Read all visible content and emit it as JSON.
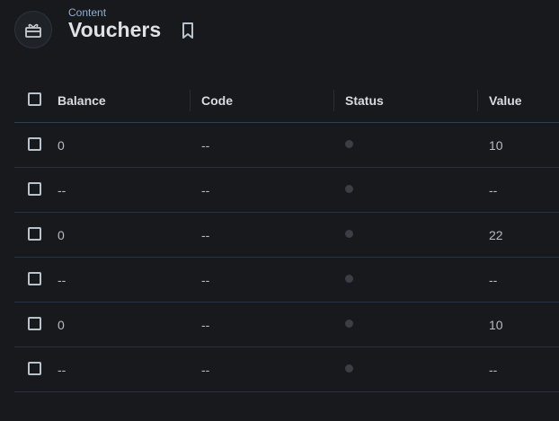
{
  "header": {
    "breadcrumb": "Content",
    "title": "Vouchers",
    "avatar_icon": "gift-icon",
    "bookmark_icon": "bookmark-icon"
  },
  "table": {
    "columns": [
      "Balance",
      "Code",
      "Status",
      "Value"
    ],
    "rows": [
      {
        "balance": "0",
        "code": "--",
        "status": "",
        "value": "10"
      },
      {
        "balance": "--",
        "code": "--",
        "status": "",
        "value": "--"
      },
      {
        "balance": "0",
        "code": "--",
        "status": "",
        "value": "22"
      },
      {
        "balance": "--",
        "code": "--",
        "status": "",
        "value": "--"
      },
      {
        "balance": "0",
        "code": "--",
        "status": "",
        "value": "10"
      },
      {
        "balance": "--",
        "code": "--",
        "status": "",
        "value": "--"
      }
    ]
  },
  "colors": {
    "background": "#18191c",
    "row_divider": "#233447",
    "breadcrumb": "#8fb0cf",
    "status_dot": "#3b3e44"
  }
}
